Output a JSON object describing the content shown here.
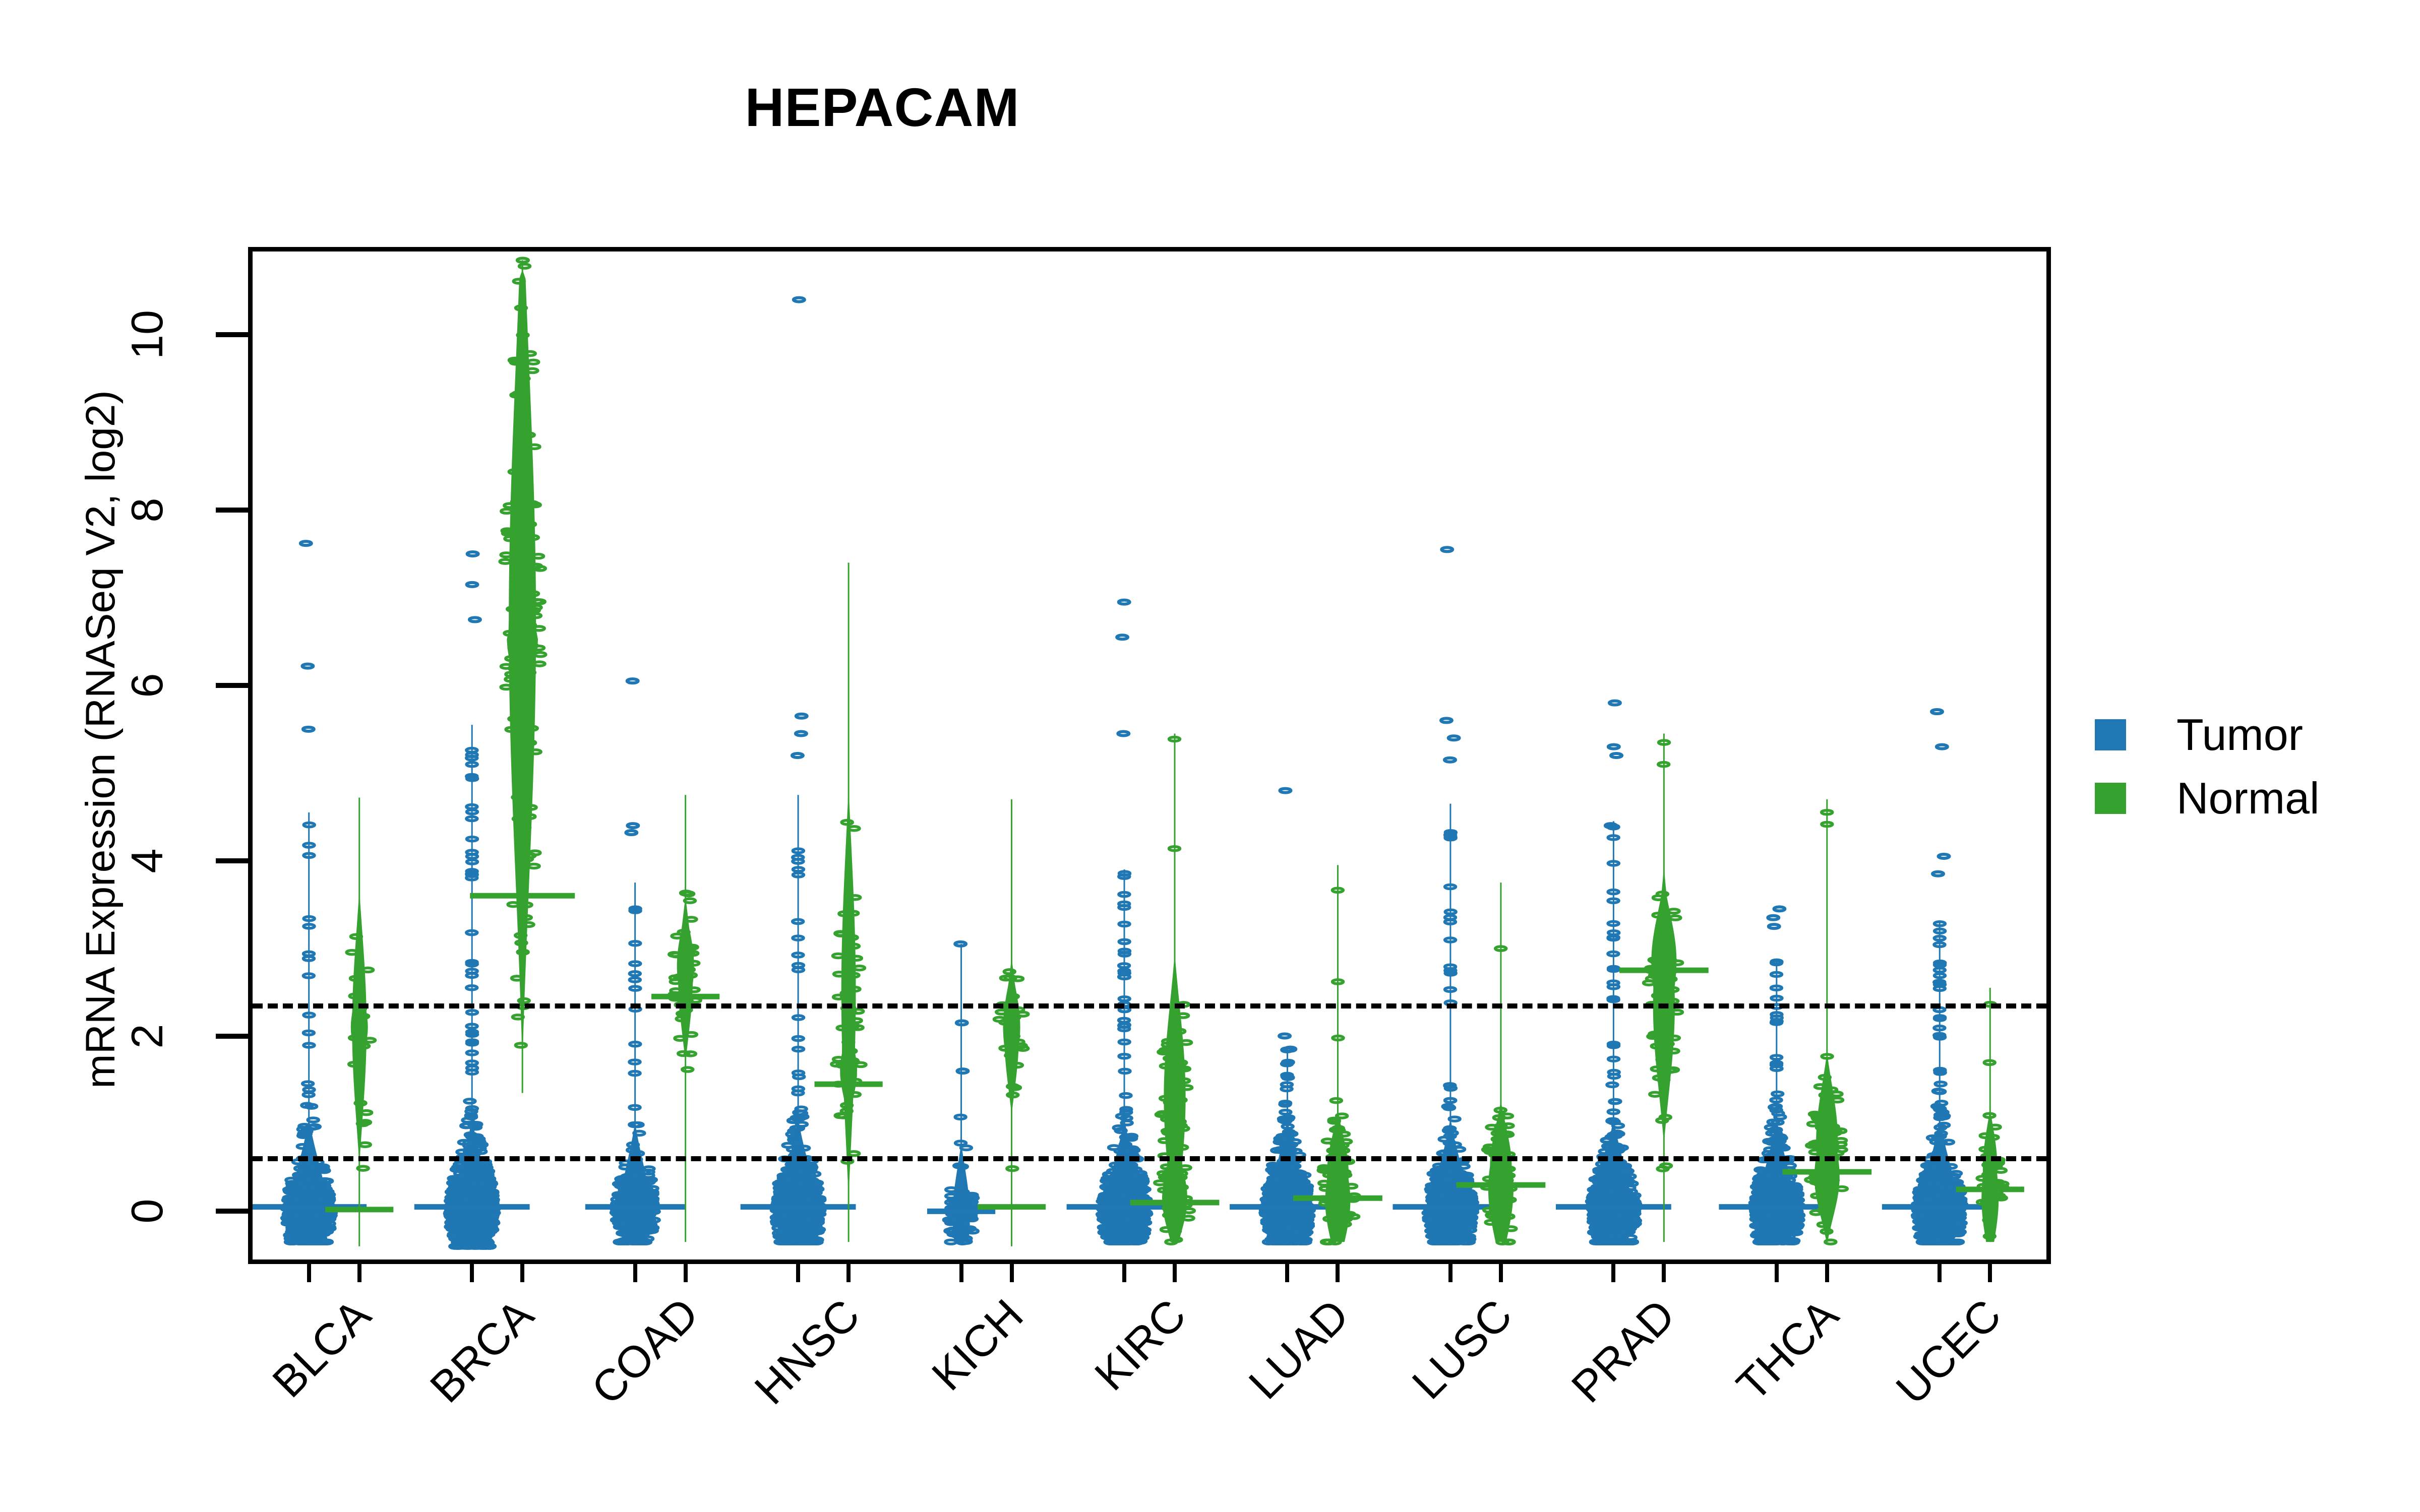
{
  "chart_data": {
    "type": "scatter",
    "plot_style": "beeswarm-violin",
    "title": "HEPACAM",
    "xlabel": "",
    "ylabel": "mRNA Expression (RNASeq V2, log2)",
    "ylim": [
      -0.55,
      10.95
    ],
    "yticks": [
      0,
      2,
      4,
      6,
      8,
      10
    ],
    "ytick_labels": [
      "0",
      "2",
      "4",
      "6",
      "8",
      "10"
    ],
    "grid": false,
    "legend_position": "right",
    "categories": [
      "BLCA",
      "BRCA",
      "COAD",
      "HNSC",
      "KICH",
      "KIRC",
      "LUAD",
      "LUSC",
      "PRAD",
      "THCA",
      "UCEC"
    ],
    "annotations": [
      {
        "type": "hline",
        "label": "upper threshold",
        "y": 2.37,
        "style": "dotted",
        "color": "#000000"
      },
      {
        "type": "hline",
        "label": "lower threshold",
        "y": 0.63,
        "style": "dotted",
        "color": "#000000"
      }
    ],
    "series": [
      {
        "name": "Tumor",
        "color": "#1F77B4"
      },
      {
        "name": "Normal",
        "color": "#35A22F"
      }
    ],
    "groups": [
      {
        "category": "BLCA",
        "tumor": {
          "n": 408,
          "median": 0.05,
          "max": 7.62,
          "min": -0.35,
          "top_outliers": [
            7.62,
            6.22,
            5.5
          ],
          "body_top": 4.55,
          "dense_from": -0.3,
          "dense_to": 0.35,
          "bulge": 0.0,
          "bulge_w": 1.0
        },
        "normal": {
          "n": 19,
          "median": 0.02,
          "max": 4.72,
          "min": -0.4,
          "top_outliers": [],
          "body_top": 4.72,
          "dense_from": 0.7,
          "dense_to": 3.5,
          "bulge": 2.1,
          "bulge_w": 0.55
        }
      },
      {
        "category": "BRCA",
        "tumor": {
          "n": 1100,
          "median": 0.05,
          "max": 7.5,
          "min": -0.4,
          "top_outliers": [
            7.5,
            7.15,
            6.75
          ],
          "body_top": 5.55,
          "dense_from": -0.3,
          "dense_to": 0.45,
          "bulge": 0.0,
          "bulge_w": 1.0
        },
        "normal": {
          "n": 112,
          "median": 3.6,
          "max": 10.85,
          "min": 1.35,
          "top_outliers": [],
          "body_top": 10.85,
          "dense_from": 3.0,
          "dense_to": 10.4,
          "bulge": 6.5,
          "bulge_w": 0.5
        }
      },
      {
        "category": "COAD",
        "tumor": {
          "n": 286,
          "median": 0.05,
          "max": 6.05,
          "min": -0.35,
          "top_outliers": [
            6.05,
            4.4,
            4.32
          ],
          "body_top": 3.75,
          "dense_from": -0.3,
          "dense_to": 0.4,
          "bulge": 0.0,
          "bulge_w": 1.0
        },
        "normal": {
          "n": 41,
          "median": 2.45,
          "max": 4.75,
          "min": -0.35,
          "top_outliers": [],
          "body_top": 4.75,
          "dense_from": 1.8,
          "dense_to": 3.5,
          "bulge": 2.8,
          "bulge_w": 0.75
        }
      },
      {
        "category": "HNSC",
        "tumor": {
          "n": 520,
          "median": 0.05,
          "max": 10.4,
          "min": -0.35,
          "top_outliers": [
            10.4,
            5.65,
            5.45,
            5.2
          ],
          "body_top": 4.75,
          "dense_from": -0.3,
          "dense_to": 0.4,
          "bulge": 0.0,
          "bulge_w": 1.0
        },
        "normal": {
          "n": 44,
          "median": 1.45,
          "max": 7.4,
          "min": -0.35,
          "top_outliers": [],
          "body_top": 7.4,
          "dense_from": 0.4,
          "dense_to": 4.6,
          "bulge": 1.6,
          "bulge_w": 0.6
        }
      },
      {
        "category": "KICH",
        "tumor": {
          "n": 66,
          "median": 0.0,
          "max": 3.05,
          "min": -0.35,
          "top_outliers": [
            3.05,
            2.15,
            1.6
          ],
          "body_top": 3.05,
          "dense_from": -0.3,
          "dense_to": 0.25,
          "bulge": -0.05,
          "bulge_w": 0.95
        },
        "normal": {
          "n": 25,
          "median": 0.05,
          "max": 4.7,
          "min": -0.4,
          "top_outliers": [],
          "body_top": 4.7,
          "dense_from": 1.2,
          "dense_to": 2.8,
          "bulge": 2.1,
          "bulge_w": 0.8
        }
      },
      {
        "category": "KIRC",
        "tumor": {
          "n": 533,
          "median": 0.05,
          "max": 6.95,
          "min": -0.35,
          "top_outliers": [
            6.95,
            6.55,
            5.45
          ],
          "body_top": 3.9,
          "dense_from": -0.3,
          "dense_to": 0.4,
          "bulge": 0.0,
          "bulge_w": 1.0
        },
        "normal": {
          "n": 72,
          "median": 0.1,
          "max": 5.45,
          "min": -0.35,
          "top_outliers": [],
          "body_top": 5.45,
          "dense_from": 0.0,
          "dense_to": 2.6,
          "bulge": 0.15,
          "bulge_w": 0.7
        }
      },
      {
        "category": "LUAD",
        "tumor": {
          "n": 517,
          "median": 0.05,
          "max": 4.8,
          "min": -0.35,
          "top_outliers": [
            4.8,
            2.0,
            1.85,
            1.7
          ],
          "body_top": 1.85,
          "dense_from": -0.3,
          "dense_to": 0.4,
          "bulge": 0.0,
          "bulge_w": 1.0
        },
        "normal": {
          "n": 59,
          "median": 0.15,
          "max": 3.95,
          "min": -0.35,
          "top_outliers": [],
          "body_top": 3.95,
          "dense_from": -0.15,
          "dense_to": 1.0,
          "bulge": 0.12,
          "bulge_w": 0.85
        }
      },
      {
        "category": "LUSC",
        "tumor": {
          "n": 501,
          "median": 0.05,
          "max": 7.55,
          "min": -0.35,
          "top_outliers": [
            7.55,
            5.6,
            5.4,
            5.15
          ],
          "body_top": 4.65,
          "dense_from": -0.3,
          "dense_to": 0.4,
          "bulge": 0.0,
          "bulge_w": 1.0
        },
        "normal": {
          "n": 51,
          "median": 0.3,
          "max": 3.75,
          "min": -0.35,
          "top_outliers": [],
          "body_top": 3.75,
          "dense_from": -0.1,
          "dense_to": 1.1,
          "bulge": 0.25,
          "bulge_w": 0.95
        }
      },
      {
        "category": "PRAD",
        "tumor": {
          "n": 498,
          "median": 0.05,
          "max": 5.8,
          "min": -0.35,
          "top_outliers": [
            5.8,
            5.3,
            5.2,
            4.4
          ],
          "body_top": 4.45,
          "dense_from": -0.3,
          "dense_to": 0.4,
          "bulge": 0.0,
          "bulge_w": 1.0
        },
        "normal": {
          "n": 52,
          "median": 2.75,
          "max": 5.45,
          "min": -0.35,
          "top_outliers": [],
          "body_top": 5.45,
          "dense_from": 1.1,
          "dense_to": 3.6,
          "bulge": 2.85,
          "bulge_w": 0.95
        }
      },
      {
        "category": "THCA",
        "tumor": {
          "n": 509,
          "median": 0.05,
          "max": 3.45,
          "min": -0.35,
          "top_outliers": [
            3.45,
            3.35,
            3.25
          ],
          "body_top": 2.85,
          "dense_from": -0.3,
          "dense_to": 0.45,
          "bulge": 0.0,
          "bulge_w": 1.0
        },
        "normal": {
          "n": 59,
          "median": 0.45,
          "max": 4.7,
          "min": -0.35,
          "top_outliers": [],
          "body_top": 4.7,
          "dense_from": 0.0,
          "dense_to": 1.6,
          "bulge": 0.4,
          "bulge_w": 0.8
        }
      },
      {
        "category": "UCEC",
        "tumor": {
          "n": 545,
          "median": 0.05,
          "max": 5.7,
          "min": -0.35,
          "top_outliers": [
            5.7,
            5.3,
            4.05,
            3.85
          ],
          "body_top": 3.3,
          "dense_from": -0.3,
          "dense_to": 0.4,
          "bulge": 0.0,
          "bulge_w": 1.0
        },
        "normal": {
          "n": 35,
          "median": 0.25,
          "max": 2.55,
          "min": -0.35,
          "top_outliers": [],
          "body_top": 2.55,
          "dense_from": -0.1,
          "dense_to": 1.1,
          "bulge": 0.15,
          "bulge_w": 0.9
        }
      }
    ]
  },
  "legend": {
    "items": [
      {
        "label": "Tumor",
        "color": "#1F77B4"
      },
      {
        "label": "Normal",
        "color": "#35A22F"
      }
    ]
  }
}
